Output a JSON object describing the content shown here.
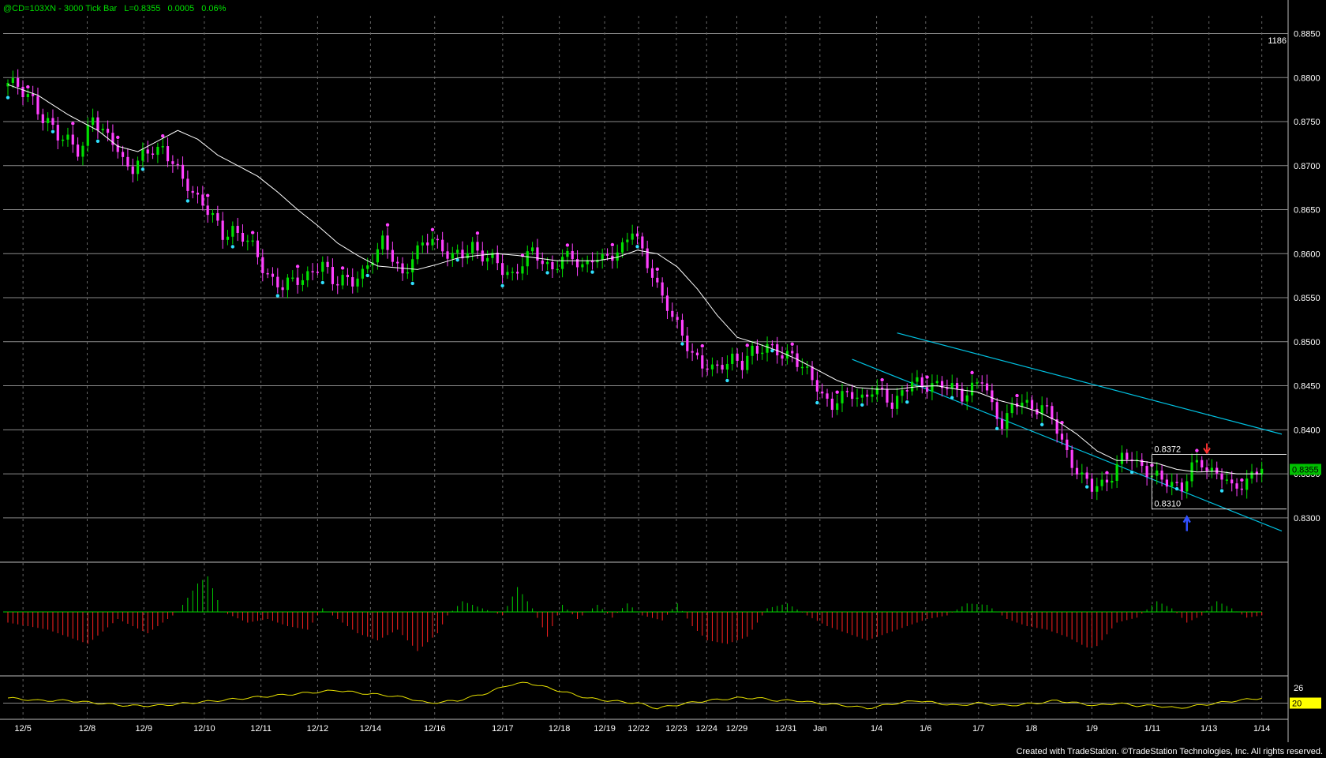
{
  "header": {
    "title": "@CD=103XN - 3000 Tick Bar",
    "last": "L=0.8355",
    "change": "0.0005",
    "pct": "0.06%"
  },
  "bar_count": "1186",
  "footer": "Created with TradeStation. ©TradeStation Technologies, Inc. All rights reserved.",
  "colors": {
    "background": "#000000",
    "grid": "#8a8a8a",
    "up_candle": "#00e000",
    "down_candle": "#ff40ff",
    "moving_average": "#ffffff",
    "channel": "#00c0e0",
    "swing_high_dot": "#ff40ff",
    "swing_low_dot": "#30e0ff",
    "histogram_pos": "#00d000",
    "histogram_neg": "#ff2020",
    "lower_line": "#e6e000",
    "price_marker_bg": "#00c000",
    "lower_marker_bg": "#ffff00"
  },
  "chart_data": {
    "type": "candlestick",
    "ylim": [
      0.8255,
      0.8872
    ],
    "yticks": [
      "0.8850",
      "0.8800",
      "0.8750",
      "0.8700",
      "0.8650",
      "0.8600",
      "0.8550",
      "0.8500",
      "0.8450",
      "0.8400",
      "0.8350",
      "0.8300"
    ],
    "xlabels": [
      "12/5",
      "12/8",
      "12/9",
      "12/10",
      "12/11",
      "12/12",
      "12/14",
      "12/16",
      "12/17",
      "12/18",
      "12/19",
      "12/22",
      "12/23",
      "12/24",
      "12/29",
      "12/31",
      "Jan",
      "1/4",
      "1/6",
      "1/7",
      "1/8",
      "1/9",
      "1/11",
      "1/13",
      "1/14"
    ],
    "last_price": "0.8355",
    "annotations": {
      "high": "0.8372",
      "low": "0.8310"
    },
    "close_path": [
      [
        0,
        0.879
      ],
      [
        2,
        0.8792
      ],
      [
        4,
        0.8782
      ],
      [
        5,
        0.8775
      ],
      [
        6,
        0.876
      ],
      [
        7,
        0.8748
      ],
      [
        9,
        0.8745
      ],
      [
        10,
        0.8738
      ],
      [
        12,
        0.873
      ],
      [
        13,
        0.8722
      ],
      [
        14,
        0.8712
      ],
      [
        15,
        0.8718
      ],
      [
        16,
        0.8742
      ],
      [
        17,
        0.8762
      ],
      [
        18,
        0.8748
      ],
      [
        19,
        0.8738
      ],
      [
        21,
        0.8725
      ],
      [
        23,
        0.8705
      ],
      [
        25,
        0.87
      ],
      [
        27,
        0.871
      ],
      [
        29,
        0.8715
      ],
      [
        31,
        0.8722
      ],
      [
        33,
        0.8705
      ],
      [
        35,
        0.868
      ],
      [
        37,
        0.867
      ],
      [
        39,
        0.866
      ],
      [
        41,
        0.864
      ],
      [
        43,
        0.8618
      ],
      [
        45,
        0.863
      ],
      [
        47,
        0.862
      ],
      [
        49,
        0.8605
      ],
      [
        51,
        0.8585
      ],
      [
        53,
        0.8572
      ],
      [
        55,
        0.856
      ],
      [
        57,
        0.8568
      ],
      [
        59,
        0.8575
      ],
      [
        61,
        0.858
      ],
      [
        63,
        0.8585
      ],
      [
        65,
        0.857
      ],
      [
        67,
        0.8575
      ],
      [
        69,
        0.8565
      ],
      [
        71,
        0.8575
      ],
      [
        73,
        0.86
      ],
      [
        75,
        0.8615
      ],
      [
        77,
        0.8592
      ],
      [
        79,
        0.8575
      ],
      [
        81,
        0.86
      ],
      [
        83,
        0.8608
      ],
      [
        85,
        0.8615
      ],
      [
        87,
        0.8608
      ],
      [
        89,
        0.8598
      ],
      [
        91,
        0.8595
      ],
      [
        93,
        0.861
      ],
      [
        95,
        0.86
      ],
      [
        97,
        0.8592
      ],
      [
        99,
        0.858
      ],
      [
        101,
        0.8578
      ],
      [
        103,
        0.859
      ],
      [
        105,
        0.86
      ],
      [
        107,
        0.8592
      ],
      [
        109,
        0.8585
      ],
      [
        111,
        0.8592
      ],
      [
        113,
        0.8595
      ],
      [
        115,
        0.8588
      ],
      [
        117,
        0.8595
      ],
      [
        119,
        0.859
      ],
      [
        121,
        0.86
      ],
      [
        123,
        0.861
      ],
      [
        125,
        0.8625
      ],
      [
        127,
        0.86
      ],
      [
        129,
        0.858
      ],
      [
        131,
        0.855
      ],
      [
        133,
        0.8525
      ],
      [
        135,
        0.851
      ],
      [
        137,
        0.8488
      ],
      [
        139,
        0.847
      ],
      [
        141,
        0.8468
      ],
      [
        143,
        0.8478
      ],
      [
        145,
        0.848
      ],
      [
        147,
        0.847
      ],
      [
        149,
        0.8492
      ],
      [
        151,
        0.8495
      ],
      [
        153,
        0.849
      ],
      [
        155,
        0.8482
      ],
      [
        157,
        0.849
      ],
      [
        159,
        0.847
      ],
      [
        161,
        0.8455
      ],
      [
        163,
        0.844
      ],
      [
        165,
        0.843
      ],
      [
        167,
        0.8435
      ],
      [
        169,
        0.844
      ],
      [
        171,
        0.8438
      ],
      [
        173,
        0.8445
      ],
      [
        175,
        0.8438
      ],
      [
        177,
        0.843
      ],
      [
        179,
        0.8445
      ],
      [
        181,
        0.8452
      ],
      [
        183,
        0.8448
      ],
      [
        185,
        0.8455
      ],
      [
        187,
        0.845
      ],
      [
        189,
        0.8445
      ],
      [
        191,
        0.844
      ],
      [
        193,
        0.845
      ],
      [
        195,
        0.8455
      ],
      [
        197,
        0.8425
      ],
      [
        199,
        0.841
      ],
      [
        201,
        0.8425
      ],
      [
        203,
        0.843
      ],
      [
        205,
        0.8425
      ],
      [
        207,
        0.843
      ],
      [
        209,
        0.841
      ],
      [
        211,
        0.8385
      ],
      [
        213,
        0.8365
      ],
      [
        215,
        0.8345
      ],
      [
        217,
        0.8332
      ],
      [
        219,
        0.834
      ],
      [
        221,
        0.835
      ],
      [
        223,
        0.8365
      ],
      [
        225,
        0.8368
      ],
      [
        227,
        0.836
      ],
      [
        229,
        0.8348
      ],
      [
        231,
        0.834
      ],
      [
        233,
        0.8342
      ],
      [
        235,
        0.8335
      ],
      [
        237,
        0.8355
      ],
      [
        239,
        0.8362
      ],
      [
        241,
        0.8355
      ],
      [
        243,
        0.8348
      ],
      [
        245,
        0.833
      ],
      [
        247,
        0.834
      ],
      [
        249,
        0.835
      ],
      [
        251,
        0.8355
      ]
    ],
    "ma_path": [
      [
        0,
        0.8792
      ],
      [
        6,
        0.878
      ],
      [
        12,
        0.8758
      ],
      [
        18,
        0.874
      ],
      [
        22,
        0.8722
      ],
      [
        26,
        0.8716
      ],
      [
        30,
        0.8728
      ],
      [
        34,
        0.874
      ],
      [
        38,
        0.873
      ],
      [
        42,
        0.8712
      ],
      [
        46,
        0.87
      ],
      [
        50,
        0.8688
      ],
      [
        54,
        0.867
      ],
      [
        58,
        0.865
      ],
      [
        62,
        0.8632
      ],
      [
        66,
        0.8612
      ],
      [
        70,
        0.8598
      ],
      [
        74,
        0.8586
      ],
      [
        78,
        0.8584
      ],
      [
        82,
        0.8582
      ],
      [
        86,
        0.8588
      ],
      [
        90,
        0.8595
      ],
      [
        94,
        0.8598
      ],
      [
        98,
        0.86
      ],
      [
        102,
        0.8598
      ],
      [
        106,
        0.8595
      ],
      [
        110,
        0.8592
      ],
      [
        114,
        0.8592
      ],
      [
        118,
        0.8592
      ],
      [
        122,
        0.8596
      ],
      [
        126,
        0.8604
      ],
      [
        130,
        0.86
      ],
      [
        134,
        0.8585
      ],
      [
        138,
        0.856
      ],
      [
        142,
        0.853
      ],
      [
        146,
        0.8505
      ],
      [
        150,
        0.8498
      ],
      [
        154,
        0.849
      ],
      [
        158,
        0.848
      ],
      [
        162,
        0.8468
      ],
      [
        166,
        0.8456
      ],
      [
        170,
        0.8448
      ],
      [
        174,
        0.8446
      ],
      [
        178,
        0.8446
      ],
      [
        182,
        0.8449
      ],
      [
        186,
        0.845
      ],
      [
        190,
        0.8446
      ],
      [
        194,
        0.8443
      ],
      [
        198,
        0.8434
      ],
      [
        202,
        0.8428
      ],
      [
        206,
        0.8421
      ],
      [
        210,
        0.841
      ],
      [
        214,
        0.8395
      ],
      [
        218,
        0.8376
      ],
      [
        222,
        0.8365
      ],
      [
        226,
        0.8365
      ],
      [
        230,
        0.8362
      ],
      [
        234,
        0.8355
      ],
      [
        238,
        0.8352
      ],
      [
        242,
        0.8353
      ],
      [
        246,
        0.835
      ],
      [
        251,
        0.835
      ]
    ],
    "channel": {
      "upper": [
        [
          178,
          0.851
        ],
        [
          255,
          0.8395
        ]
      ],
      "lower": [
        [
          169,
          0.848
        ],
        [
          255,
          0.8285
        ]
      ]
    },
    "oscillator": {
      "zero": 0,
      "points": [
        [
          0,
          -15
        ],
        [
          8,
          -25
        ],
        [
          16,
          -45
        ],
        [
          22,
          -10
        ],
        [
          28,
          -30
        ],
        [
          34,
          0
        ],
        [
          38,
          40
        ],
        [
          40,
          50
        ],
        [
          43,
          0
        ],
        [
          48,
          -15
        ],
        [
          52,
          -10
        ],
        [
          56,
          -20
        ],
        [
          60,
          -25
        ],
        [
          63,
          5
        ],
        [
          66,
          -10
        ],
        [
          70,
          -30
        ],
        [
          74,
          -40
        ],
        [
          78,
          -25
        ],
        [
          82,
          -55
        ],
        [
          86,
          -30
        ],
        [
          88,
          -5
        ],
        [
          91,
          15
        ],
        [
          95,
          5
        ],
        [
          99,
          -5
        ],
        [
          102,
          35
        ],
        [
          105,
          5
        ],
        [
          108,
          -35
        ],
        [
          111,
          10
        ],
        [
          114,
          -10
        ],
        [
          118,
          10
        ],
        [
          121,
          -8
        ],
        [
          124,
          12
        ],
        [
          127,
          -5
        ],
        [
          131,
          -12
        ],
        [
          134,
          12
        ],
        [
          137,
          -20
        ],
        [
          140,
          -40
        ],
        [
          144,
          -45
        ],
        [
          148,
          -35
        ],
        [
          152,
          5
        ],
        [
          156,
          12
        ],
        [
          160,
          -5
        ],
        [
          164,
          -20
        ],
        [
          168,
          -30
        ],
        [
          172,
          -40
        ],
        [
          176,
          -30
        ],
        [
          180,
          -20
        ],
        [
          184,
          -10
        ],
        [
          188,
          -5
        ],
        [
          192,
          12
        ],
        [
          196,
          10
        ],
        [
          200,
          -10
        ],
        [
          204,
          -20
        ],
        [
          208,
          -25
        ],
        [
          212,
          -35
        ],
        [
          216,
          -50
        ],
        [
          218,
          -48
        ],
        [
          222,
          -15
        ],
        [
          226,
          -8
        ],
        [
          230,
          15
        ],
        [
          233,
          5
        ],
        [
          236,
          -15
        ],
        [
          239,
          -5
        ],
        [
          242,
          15
        ],
        [
          245,
          5
        ],
        [
          248,
          -8
        ],
        [
          251,
          -5
        ]
      ]
    },
    "lower_indicator": {
      "ylim": [
        14,
        30
      ],
      "label_value": "26",
      "level": 20,
      "points": [
        [
          0,
          22
        ],
        [
          6,
          21
        ],
        [
          12,
          21
        ],
        [
          18,
          20
        ],
        [
          24,
          19
        ],
        [
          30,
          19
        ],
        [
          36,
          20
        ],
        [
          42,
          21
        ],
        [
          48,
          22
        ],
        [
          54,
          23
        ],
        [
          60,
          24
        ],
        [
          66,
          25
        ],
        [
          70,
          24
        ],
        [
          76,
          23
        ],
        [
          80,
          22
        ],
        [
          84,
          20
        ],
        [
          90,
          21
        ],
        [
          96,
          24
        ],
        [
          100,
          27
        ],
        [
          104,
          28
        ],
        [
          110,
          25
        ],
        [
          116,
          22
        ],
        [
          120,
          21
        ],
        [
          126,
          20
        ],
        [
          130,
          18
        ],
        [
          136,
          20
        ],
        [
          140,
          21
        ],
        [
          146,
          22
        ],
        [
          150,
          22
        ],
        [
          154,
          21
        ],
        [
          158,
          21
        ],
        [
          162,
          20
        ],
        [
          168,
          19
        ],
        [
          172,
          18
        ],
        [
          178,
          20
        ],
        [
          182,
          21
        ],
        [
          186,
          20
        ],
        [
          190,
          19
        ],
        [
          194,
          20
        ],
        [
          200,
          19
        ],
        [
          206,
          20
        ],
        [
          210,
          21
        ],
        [
          214,
          20
        ],
        [
          218,
          19
        ],
        [
          222,
          20
        ],
        [
          226,
          19
        ],
        [
          230,
          19
        ],
        [
          234,
          18
        ],
        [
          238,
          19
        ],
        [
          242,
          20
        ],
        [
          246,
          21
        ],
        [
          251,
          22
        ]
      ]
    }
  }
}
